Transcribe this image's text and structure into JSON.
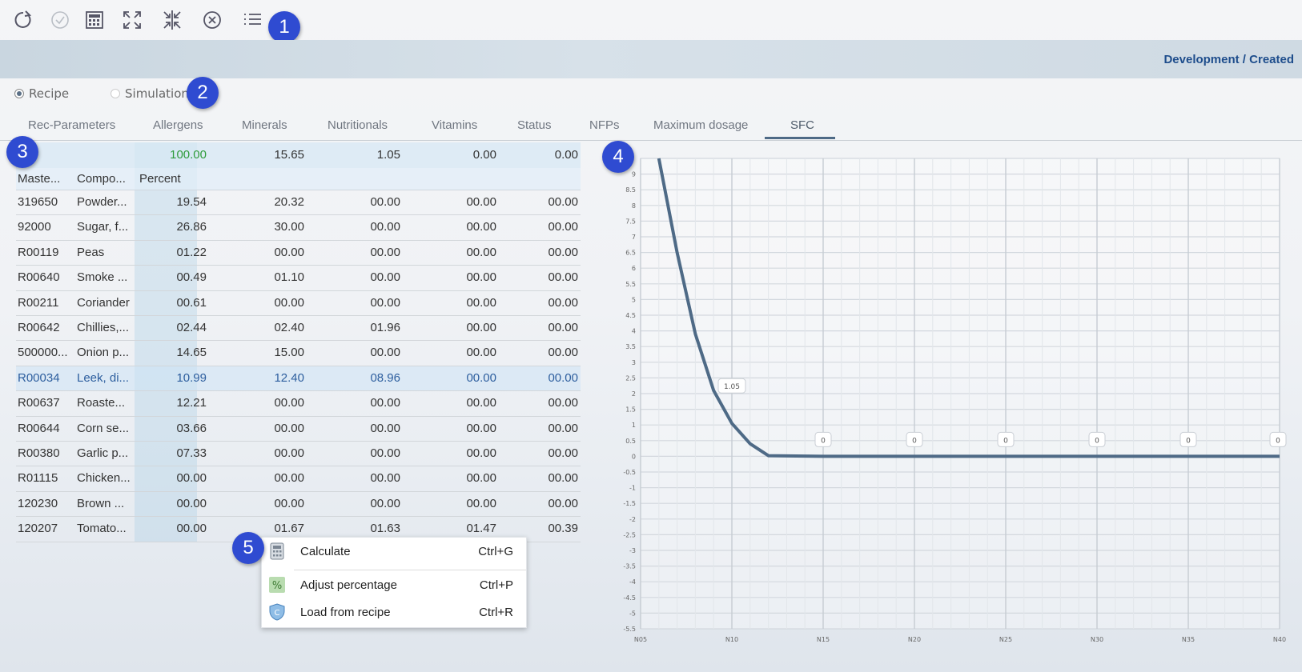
{
  "toolbar": {
    "icons": [
      "refresh-icon",
      "check-circle-icon",
      "calculator-icon",
      "expand-icon",
      "collapse-icon",
      "close-circle-icon",
      "list-icon"
    ]
  },
  "header": {
    "status": "Development / Created"
  },
  "mode": {
    "recipe_label": "Recipe",
    "simulation_label": "Simulation",
    "selected": "Recipe"
  },
  "tabs": [
    {
      "label": "Rec-Parameters"
    },
    {
      "label": "Allergens"
    },
    {
      "label": "Minerals"
    },
    {
      "label": "Nutritionals"
    },
    {
      "label": "Vitamins"
    },
    {
      "label": "Status"
    },
    {
      "label": "NFPs"
    },
    {
      "label": "Maximum dosage"
    },
    {
      "label": "SFC"
    }
  ],
  "active_tab": "SFC",
  "grid": {
    "totals": [
      "100.00",
      "15.65",
      "1.05",
      "0.00",
      "0.00"
    ],
    "headers": [
      "Maste...",
      "Compo...",
      "Percent"
    ],
    "rows": [
      [
        "319650",
        "Powder...",
        "19.54",
        "20.32",
        "00.00",
        "00.00",
        "00.00"
      ],
      [
        "92000",
        "Sugar, f...",
        "26.86",
        "30.00",
        "00.00",
        "00.00",
        "00.00"
      ],
      [
        "R00119",
        "Peas",
        "01.22",
        "00.00",
        "00.00",
        "00.00",
        "00.00"
      ],
      [
        "R00640",
        "Smoke ...",
        "00.49",
        "01.10",
        "00.00",
        "00.00",
        "00.00"
      ],
      [
        "R00211",
        "Coriander",
        "00.61",
        "00.00",
        "00.00",
        "00.00",
        "00.00"
      ],
      [
        "R00642",
        "Chillies,...",
        "02.44",
        "02.40",
        "01.96",
        "00.00",
        "00.00"
      ],
      [
        "500000...",
        "Onion p...",
        "14.65",
        "15.00",
        "00.00",
        "00.00",
        "00.00"
      ],
      [
        "R00034",
        "Leek, di...",
        "10.99",
        "12.40",
        "08.96",
        "00.00",
        "00.00"
      ],
      [
        "R00637",
        "Roaste...",
        "12.21",
        "00.00",
        "00.00",
        "00.00",
        "00.00"
      ],
      [
        "R00644",
        "Corn se...",
        "03.66",
        "00.00",
        "00.00",
        "00.00",
        "00.00"
      ],
      [
        "R00380",
        "Garlic p...",
        "07.33",
        "00.00",
        "00.00",
        "00.00",
        "00.00"
      ],
      [
        "R01115",
        "Chicken...",
        "00.00",
        "00.00",
        "00.00",
        "00.00",
        "00.00"
      ],
      [
        "120230",
        "Brown ...",
        "00.00",
        "00.00",
        "00.00",
        "00.00",
        "00.00"
      ],
      [
        "120207",
        "Tomato...",
        "00.00",
        "01.67",
        "01.63",
        "01.47",
        "00.39"
      ]
    ],
    "selected_row": 7
  },
  "context_menu": {
    "items": [
      {
        "label": "Calculate",
        "shortcut": "Ctrl+G",
        "icon": "calculator-icon"
      },
      {
        "label": "Adjust percentage",
        "shortcut": "Ctrl+P",
        "icon": "percent-icon"
      },
      {
        "label": "Load from recipe",
        "shortcut": "Ctrl+R",
        "icon": "shield-icon"
      }
    ]
  },
  "badges": [
    "1",
    "2",
    "3",
    "4",
    "5"
  ],
  "colors": {
    "accent": "#2f4bd1",
    "status_text": "#1e4d8c",
    "line": "#4e6a86",
    "total_green": "#2e9b3a",
    "selected_text": "#2d5e9e"
  },
  "chart_data": {
    "type": "line",
    "x": [
      "N05",
      "N10",
      "N15",
      "N20",
      "N25",
      "N30",
      "N35",
      "N40"
    ],
    "xlim": [
      5,
      40
    ],
    "ylim": [
      -5.5,
      9.5
    ],
    "ytick_step": 0.5,
    "grid": true,
    "series": [
      {
        "values": [
          [
            6,
            9.5
          ],
          [
            7,
            6.5
          ],
          [
            8,
            3.9
          ],
          [
            9,
            2.1
          ],
          [
            10,
            1.05
          ],
          [
            11,
            0.4
          ],
          [
            12,
            0.02
          ],
          [
            15,
            0
          ],
          [
            20,
            0
          ],
          [
            25,
            0
          ],
          [
            30,
            0
          ],
          [
            35,
            0
          ],
          [
            40,
            0
          ]
        ]
      }
    ],
    "data_labels": [
      {
        "x": 10,
        "y": 1.05,
        "text": "1.05"
      },
      {
        "x": 15,
        "y": 0,
        "text": "0"
      },
      {
        "x": 20,
        "y": 0,
        "text": "0"
      },
      {
        "x": 25,
        "y": 0,
        "text": "0"
      },
      {
        "x": 30,
        "y": 0,
        "text": "0"
      },
      {
        "x": 35,
        "y": 0,
        "text": "0"
      },
      {
        "x": 40,
        "y": 0,
        "text": "0"
      }
    ]
  }
}
